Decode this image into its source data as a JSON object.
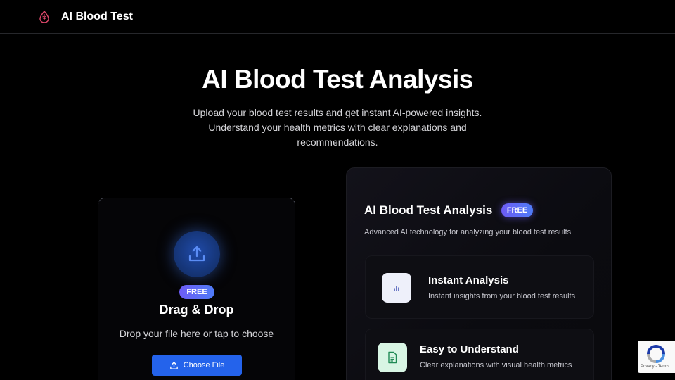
{
  "header": {
    "brand": "AI Blood Test"
  },
  "hero": {
    "title": "AI Blood Test Analysis",
    "subtitle": "Upload your blood test results and get instant AI-powered insights. Understand your health metrics with clear explanations and recommendations."
  },
  "dropzone": {
    "badge": "FREE",
    "title": "Drag & Drop",
    "subtitle": "Drop your file here or tap to choose",
    "button_label": "Choose File"
  },
  "panel": {
    "title": "AI Blood Test Analysis",
    "badge": "FREE",
    "description": "Advanced AI technology for analyzing your blood test results",
    "features": [
      {
        "title": "Instant Analysis",
        "description": "Instant insights from your blood test results",
        "icon": "chart-bars-icon"
      },
      {
        "title": "Easy to Understand",
        "description": "Clear explanations with visual health metrics",
        "icon": "document-icon"
      }
    ]
  },
  "recaptcha": {
    "links": "Privacy - Terms"
  },
  "colors": {
    "background": "#000000",
    "accent_blue": "#2463eb",
    "badge_gradient_start": "#6d5cf6",
    "badge_gradient_end": "#4f7cf7",
    "logo_red": "#e0486b"
  }
}
